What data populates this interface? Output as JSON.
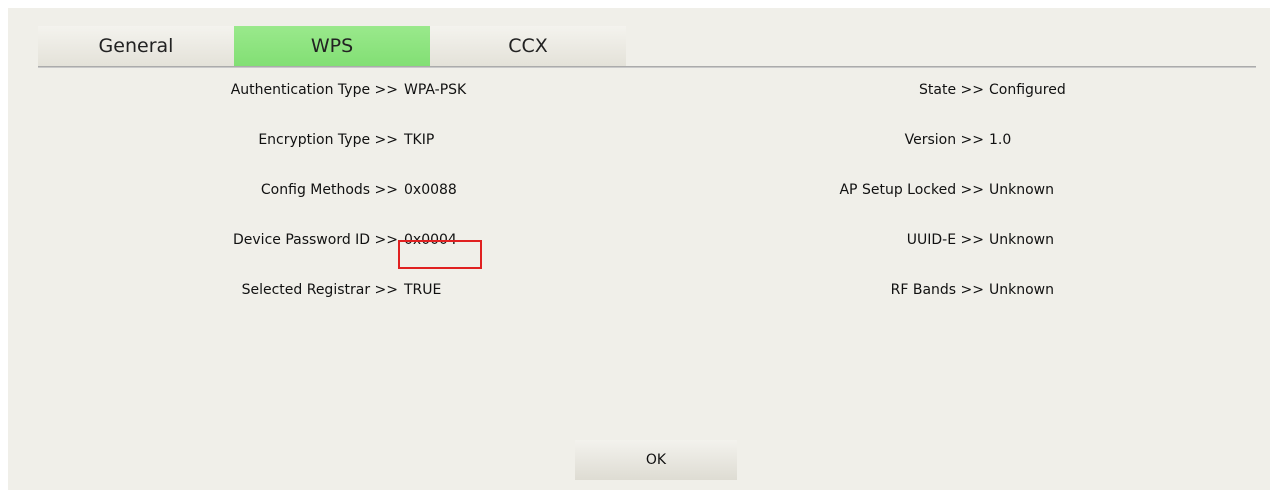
{
  "tabs": [
    {
      "label": "General"
    },
    {
      "label": "WPS"
    },
    {
      "label": "CCX"
    }
  ],
  "left_fields": [
    {
      "label": "Authentication Type >>",
      "value": "WPA-PSK"
    },
    {
      "label": "Encryption Type >>",
      "value": "TKIP"
    },
    {
      "label": "Config Methods >>",
      "value": "0x0088"
    },
    {
      "label": "Device Password ID >>",
      "value": "0x0004"
    },
    {
      "label": "Selected Registrar >>",
      "value": "TRUE"
    }
  ],
  "right_fields": [
    {
      "label": "State >>",
      "value": "Configured"
    },
    {
      "label": "Version >>",
      "value": "1.0"
    },
    {
      "label": "AP Setup Locked >>",
      "value": "Unknown"
    },
    {
      "label": "UUID-E >>",
      "value": "Unknown"
    },
    {
      "label": "RF Bands >>",
      "value": "Unknown"
    }
  ],
  "ok_label": "OK",
  "active_tab": "WPS",
  "colors": {
    "active_tab": "#86e078",
    "highlight_box": "#e02020"
  }
}
